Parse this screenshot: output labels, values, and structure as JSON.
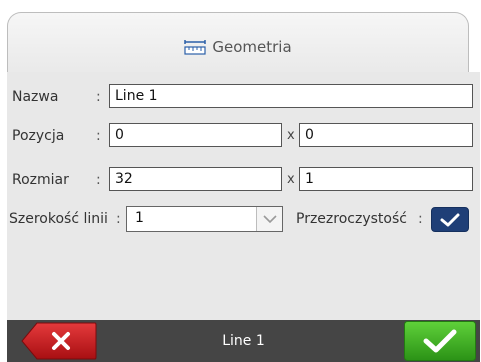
{
  "tab": {
    "title": "Geometria",
    "icon": "ruler-icon"
  },
  "form": {
    "name": {
      "label": "Nazwa",
      "colon": ":",
      "value": "Line 1"
    },
    "position": {
      "label": "Pozycja",
      "colon": ":",
      "x_value": "0",
      "separator": "x",
      "y_value": "0"
    },
    "size": {
      "label": "Rozmiar",
      "colon": ":",
      "w_value": "32",
      "separator": "x",
      "h_value": "1"
    },
    "line_width": {
      "label": "Szerokość linii",
      "colon": ":",
      "value": "1"
    },
    "transparency": {
      "label": "Przezroczystość",
      "colon": ":",
      "checked": true
    }
  },
  "bottom_bar": {
    "status_text": "Line 1",
    "cancel_icon": "close-icon",
    "ok_icon": "checkmark-icon"
  },
  "colors": {
    "cancel_button": "#c0171a",
    "ok_button": "#3cb01e",
    "checkbox": "#1f3f77",
    "bottom_bar": "#454545",
    "panel": "#e8e8e8"
  }
}
